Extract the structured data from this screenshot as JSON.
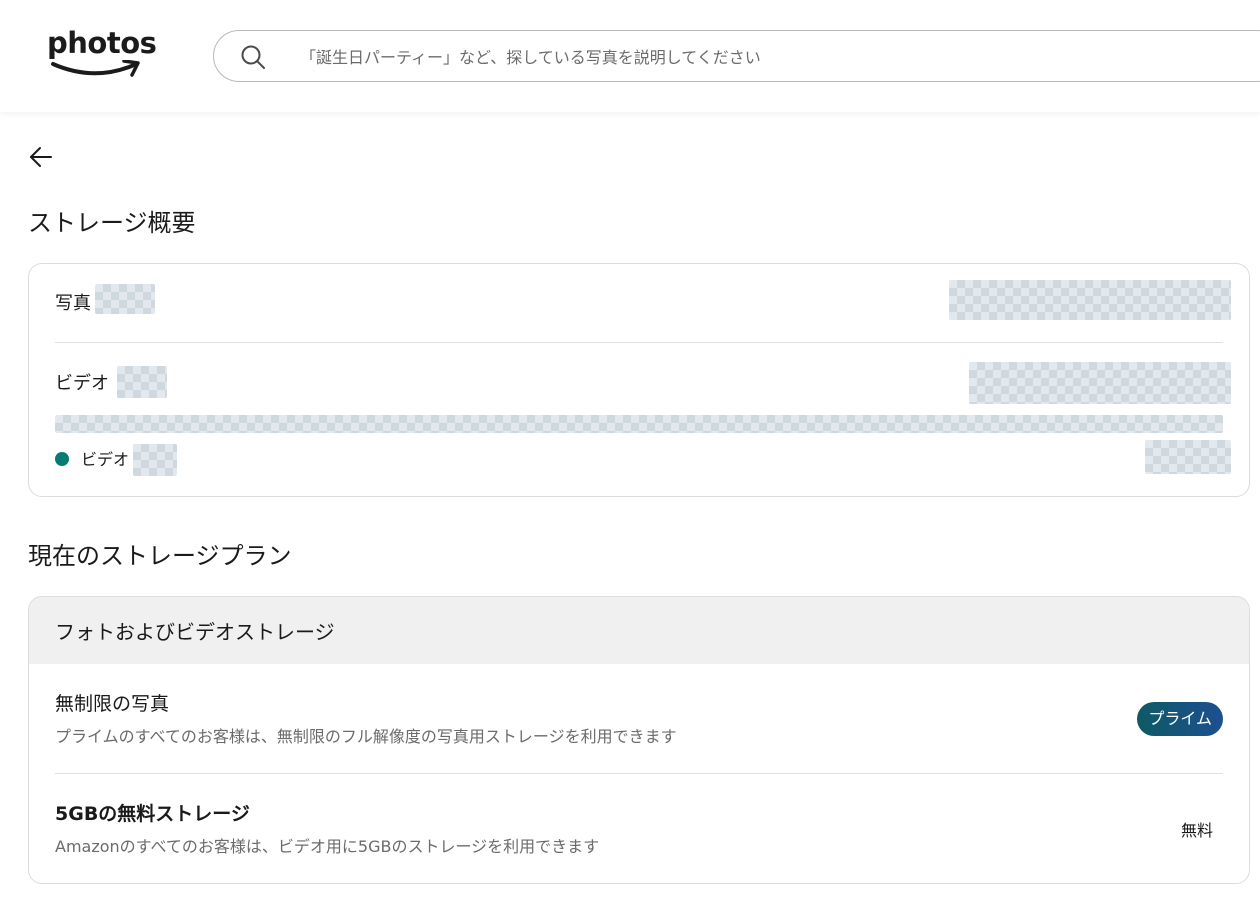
{
  "header": {
    "logo_text": "photos",
    "search_placeholder": "「誕生日パーティー」など、探している写真を説明してください"
  },
  "page": {
    "back_icon": "arrow-left-icon",
    "storage_overview_title": "ストレージ概要",
    "current_plan_title": "現在のストレージプラン"
  },
  "overview": {
    "photos_label": "写真",
    "videos_label": "ビデオ",
    "legend_label": "ビデオ",
    "legend_color": "#077a74"
  },
  "plan": {
    "section_title": "フォトおよびビデオストレージ",
    "items": [
      {
        "title": "無制限の写真",
        "description": "プライムのすべてのお客様は、無制限のフル解像度の写真用ストレージを利用できます",
        "badge": "プライム"
      },
      {
        "title": "5GBの無料ストレージ",
        "description": "Amazonのすべてのお客様は、ビデオ用に5GBのストレージを利用できます",
        "badge": "無料"
      }
    ]
  },
  "colors": {
    "accent_teal": "#077a74",
    "prime_badge_start": "#0e5a64",
    "prime_badge_end": "#1d4f91"
  }
}
